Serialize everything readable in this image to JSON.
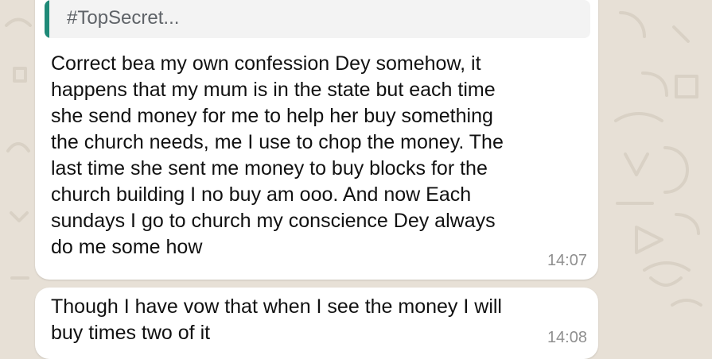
{
  "chat": {
    "message_1": {
      "quote_text": "#TopSecret...",
      "text": "Correct bea my own confession Dey somehow, it\nhappens that my mum is in the state but each time\nshe send money for me to help her buy something\nthe church needs, me I use to chop the money. The\nlast time she sent me money to buy blocks for the\nchurch building I no buy am ooo. And now Each\nsundays I go to church my conscience Dey always\ndo me some how",
      "time": "14:07"
    },
    "message_2": {
      "text": "Though I have vow that when I see the money I will\nbuy times two of it",
      "time": "14:08"
    }
  },
  "colors": {
    "wallpaper": "#e7e0d6",
    "bubble": "#ffffff",
    "quote_accent": "#1f8a78"
  }
}
